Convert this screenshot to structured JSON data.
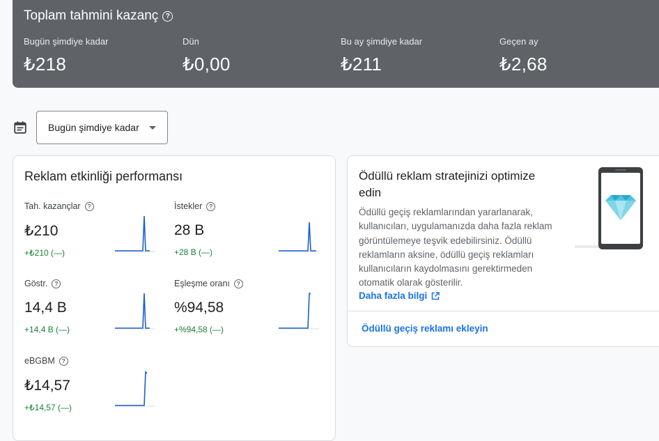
{
  "earnings": {
    "title": "Toplam tahmini kazanç",
    "stats": [
      {
        "label": "Bugün şimdiye kadar",
        "value": "₺218"
      },
      {
        "label": "Dün",
        "value": "₺0,00"
      },
      {
        "label": "Bu ay şimdiye kadar",
        "value": "₺211"
      },
      {
        "label": "Geçen ay",
        "value": "₺2,68"
      }
    ]
  },
  "date_filter": {
    "selected": "Bugün şimdiye kadar"
  },
  "performance": {
    "title": "Reklam etkinliği performansı",
    "metrics": [
      {
        "label": "Tah. kazançlar",
        "value": "₺210",
        "change": "+₺210 (—)"
      },
      {
        "label": "İstekler",
        "value": "28 B",
        "change": "+28 B (—)"
      },
      {
        "label": "Göstr.",
        "value": "14,4 B",
        "change": "+14,4 B (—)"
      },
      {
        "label": "Eşleşme oranı",
        "value": "%94,58",
        "change": "+%94,58 (—)"
      },
      {
        "label": "eBGBM",
        "value": "₺14,57",
        "change": "+₺14,57 (—)"
      }
    ]
  },
  "promo": {
    "title": "Ödüllü reklam stratejinizi optimize edin",
    "body": "Ödüllü geçiş reklamlarından yararlanarak, kullanıcıları, uygulamanızda daha fazla reklam görüntülemeye teşvik edebilirsiniz. Ödüllü reklamların aksine, ödüllü geçiş reklamları kullanıcıların kaydolmasını gerektirmeden otomatik olarak gösterilir.",
    "learn_more": "Daha fazla bilgi",
    "action": "Ödüllü geçiş reklamı ekleyin"
  },
  "colors": {
    "accent": "#1a73e8",
    "positive": "#188038",
    "header_bg": "#5f6368",
    "spark": "#1a5fd0",
    "gem": "#4fc3dc"
  }
}
